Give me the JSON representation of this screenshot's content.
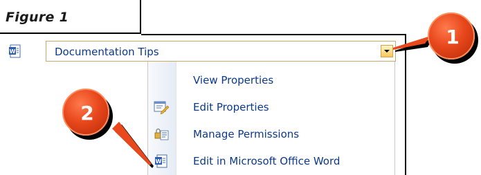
{
  "figure": {
    "caption": "Figure 1"
  },
  "title_field": {
    "value": "Documentation Tips",
    "document_icon": "word-document-icon"
  },
  "context_menu": {
    "items": [
      {
        "label": "View Properties",
        "icon": "none"
      },
      {
        "label": "Edit Properties",
        "icon": "edit-properties-icon"
      },
      {
        "label": "Manage Permissions",
        "icon": "permissions-icon"
      },
      {
        "label": "Edit in Microsoft Office Word",
        "icon": "word-document-icon"
      }
    ]
  },
  "callouts": [
    {
      "number": "1"
    },
    {
      "number": "2"
    }
  ],
  "colors": {
    "link_text": "#0b3a8c",
    "callout_fill": "#e8481c",
    "dropdown_button": "#f6c65a"
  }
}
